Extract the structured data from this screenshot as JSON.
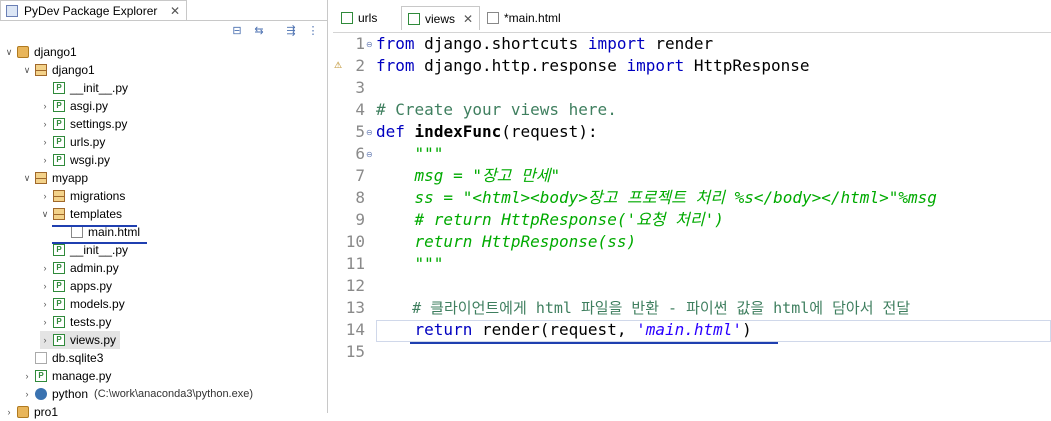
{
  "explorer": {
    "title": "PyDev Package Explorer",
    "close": "✕",
    "items": [
      {
        "label": "django1"
      },
      {
        "label": "django1"
      },
      {
        "label": "__init__.py"
      },
      {
        "label": "asgi.py"
      },
      {
        "label": "settings.py"
      },
      {
        "label": "urls.py"
      },
      {
        "label": "wsgi.py"
      },
      {
        "label": "myapp"
      },
      {
        "label": "migrations"
      },
      {
        "label": "templates"
      },
      {
        "label": "main.html"
      },
      {
        "label": "__init__.py"
      },
      {
        "label": "admin.py"
      },
      {
        "label": "apps.py"
      },
      {
        "label": "models.py"
      },
      {
        "label": "tests.py"
      },
      {
        "label": "views.py"
      },
      {
        "label": "db.sqlite3"
      },
      {
        "label": "manage.py"
      },
      {
        "label": "python",
        "extra": "(C:\\work\\anaconda3\\python.exe)"
      },
      {
        "label": "pro1"
      }
    ]
  },
  "editor": {
    "tabs": [
      {
        "label": "urls"
      },
      {
        "label": "views",
        "close": "✕"
      },
      {
        "label": "*main.html"
      }
    ],
    "lines": {
      "l1": {
        "a": "from",
        "b": " django.shortcuts ",
        "c": "import",
        "d": " render"
      },
      "l2": {
        "a": "from",
        "b": " django.http.response ",
        "c": "import",
        "d": " HttpResponse"
      },
      "l3": {},
      "l4": {
        "a": "# Create your views here."
      },
      "l5": {
        "a": "def",
        "b": " ",
        "c": "indexFunc",
        "d": "(request):"
      },
      "l6": {
        "a": "    \"\"\""
      },
      "l7": {
        "a": "    msg = \"장고 만세\""
      },
      "l8": {
        "a": "    ss = \"<html><body>장고 프로젝트 처리 %s</body></html>\"%msg"
      },
      "l9": {
        "a": "    # return HttpResponse('요청 처리')"
      },
      "l10": {
        "a": "    return HttpResponse(ss)"
      },
      "l11": {
        "a": "    \"\"\""
      },
      "l12": {},
      "l13": {
        "a": "    # 클라이언트에게 html 파일을 반환 - 파이썬 값을 html에 담아서 전달"
      },
      "l14": {
        "a": "    ",
        "b": "return",
        "c": " render(request, ",
        "d": "'main.html'",
        "e": ")"
      },
      "l15": {}
    },
    "line_numbers": [
      "1",
      "2",
      "3",
      "4",
      "5",
      "6",
      "7",
      "8",
      "9",
      "10",
      "11",
      "12",
      "13",
      "14",
      "15"
    ]
  }
}
